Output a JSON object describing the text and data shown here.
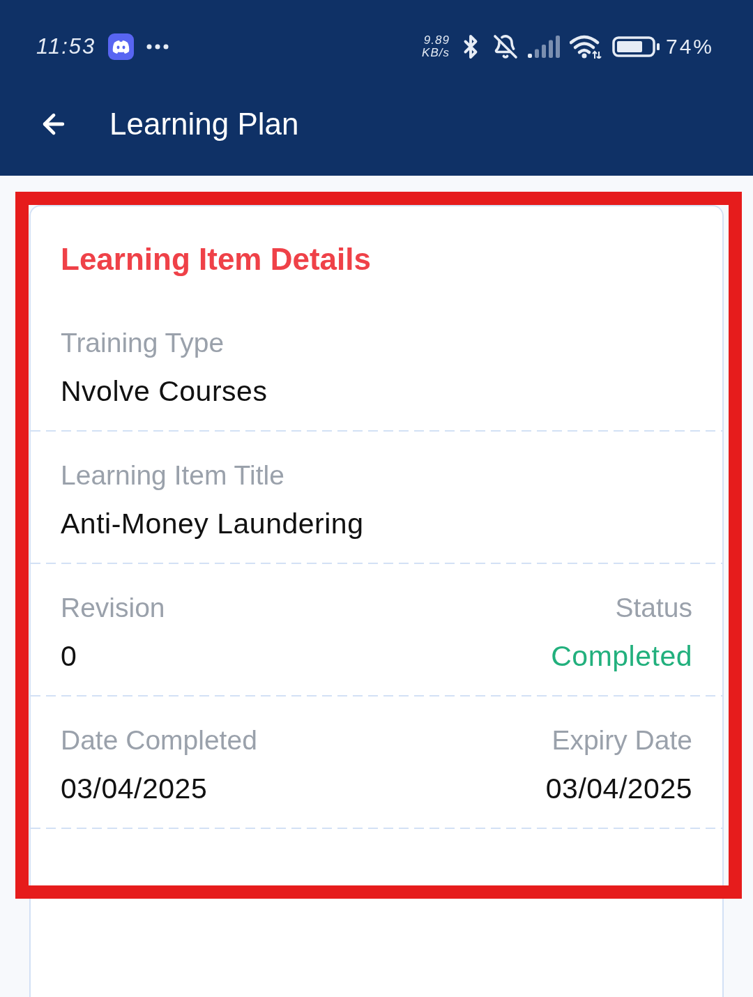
{
  "status_bar": {
    "time": "11:53",
    "network_speed": {
      "value": "9.89",
      "unit": "KB/s"
    },
    "battery": "74%"
  },
  "header": {
    "title": "Learning Plan"
  },
  "card": {
    "title": "Learning Item Details",
    "highlighted": true,
    "rows": [
      {
        "fields": [
          {
            "label": "Training Type",
            "value": "Nvolve Courses",
            "kind": "text"
          }
        ]
      },
      {
        "fields": [
          {
            "label": "Learning Item Title",
            "value": "Anti-Money Laundering",
            "kind": "text"
          }
        ]
      },
      {
        "fields": [
          {
            "label": "Revision",
            "value": "0",
            "kind": "text"
          },
          {
            "label": "Status",
            "value": "Completed",
            "kind": "status"
          }
        ]
      },
      {
        "fields": [
          {
            "label": "Date Completed",
            "value": "03/04/2025",
            "kind": "text"
          },
          {
            "label": "Expiry Date",
            "value": "03/04/2025",
            "kind": "text"
          }
        ]
      }
    ]
  }
}
